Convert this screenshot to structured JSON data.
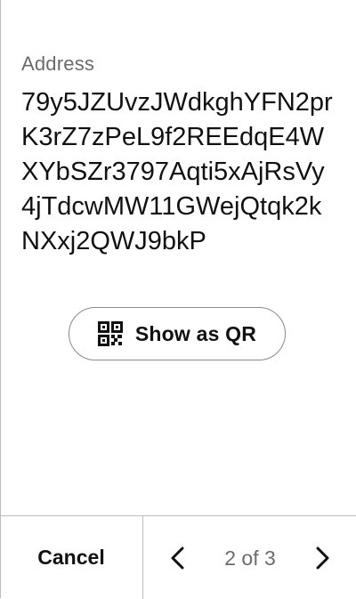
{
  "address": {
    "label": "Address",
    "value": "79y5JZUvzJWdkghYFN2prK3rZ7zPeL9f2REEdqE4WXYbSZr3797Aqti5xAjRsVy4jTdcwMW11GWejQtqk2kNXxj2QWJ9bkP"
  },
  "qr_button": {
    "label": "Show as QR",
    "icon": "qr-code-icon"
  },
  "footer": {
    "cancel_label": "Cancel",
    "pagination": {
      "text": "2 of 3",
      "current": 2,
      "total": 3,
      "prev_icon": "chevron-left-icon",
      "next_icon": "chevron-right-icon"
    }
  },
  "colors": {
    "text": "#111111",
    "muted": "#6b6b6b",
    "border": "#bdbdbd"
  }
}
